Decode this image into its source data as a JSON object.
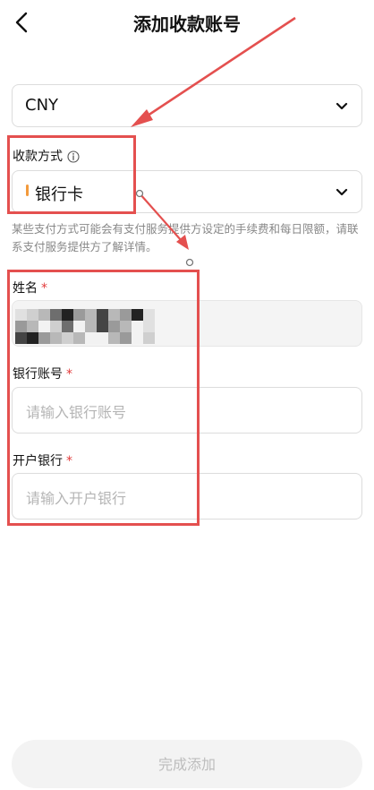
{
  "header": {
    "title": "添加收款账号"
  },
  "currency": {
    "value": "CNY"
  },
  "payment_method": {
    "label": "收款方式",
    "value": "银行卡",
    "accent_color": "#f39a3c"
  },
  "note": "某些支付方式可能会有支付服务提供方设定的手续费和每日限额，请联系支付服务提供方了解详情。",
  "form": {
    "name": {
      "label": "姓名",
      "required_mark": "*"
    },
    "account": {
      "label": "银行账号",
      "required_mark": "*",
      "placeholder": "请输入银行账号"
    },
    "bank": {
      "label": "开户银行",
      "required_mark": "*",
      "placeholder": "请输入开户银行"
    }
  },
  "submit": {
    "label": "完成添加"
  },
  "colors": {
    "annotation": "#e4504f",
    "required": "#e23b3b",
    "placeholder": "#b5b5b5"
  }
}
